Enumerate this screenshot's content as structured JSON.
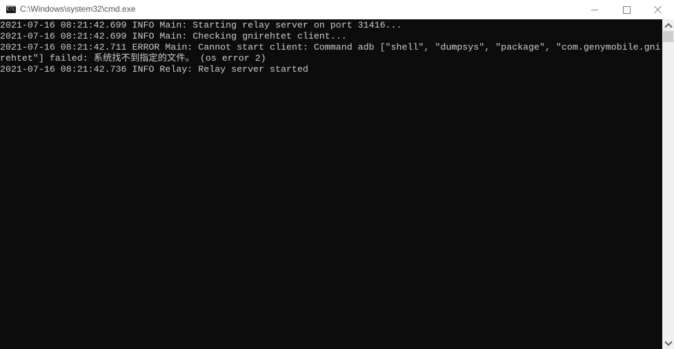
{
  "window": {
    "title": "C:\\Windows\\system32\\cmd.exe",
    "icon": "cmd-icon",
    "icon_text": "C:\\_",
    "controls": {
      "minimize": "minimize-icon",
      "maximize": "maximize-icon",
      "close": "close-icon"
    }
  },
  "console": {
    "background": "#0c0c0c",
    "foreground": "#cccccc",
    "lines": [
      "2021-07-16 08:21:42.699 INFO Main: Starting relay server on port 31416...",
      "2021-07-16 08:21:42.699 INFO Main: Checking gnirehtet client...",
      "2021-07-16 08:21:42.711 ERROR Main: Cannot start client: Command adb [\"shell\", \"dumpsys\", \"package\", \"com.genymobile.gni",
      "rehtet\"] failed: 系统找不到指定的文件。 (os error 2)",
      "2021-07-16 08:21:42.736 INFO Relay: Relay server started"
    ]
  },
  "scrollbar": {
    "up": "chevron-up-icon",
    "down": "chevron-down-icon",
    "position": 0
  }
}
